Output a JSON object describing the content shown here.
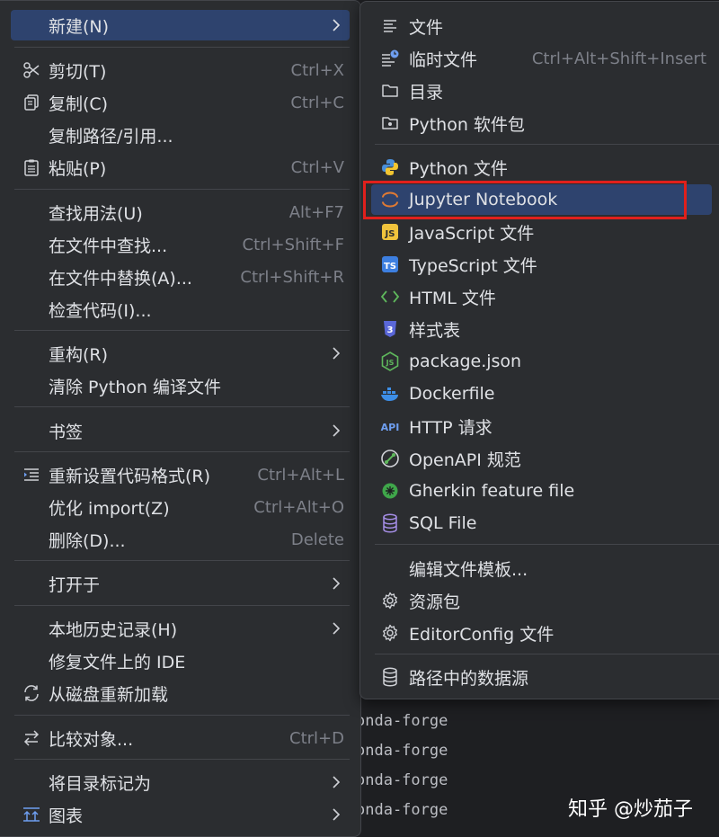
{
  "main_menu": {
    "new": "新建(N)",
    "cut": "剪切(T)",
    "cut_sc": "Ctrl+X",
    "copy": "复制(C)",
    "copy_sc": "Ctrl+C",
    "copy_path": "复制路径/引用...",
    "paste": "粘贴(P)",
    "paste_sc": "Ctrl+V",
    "find_usages": "查找用法(U)",
    "find_usages_sc": "Alt+F7",
    "find_in_files": "在文件中查找...",
    "find_in_files_sc": "Ctrl+Shift+F",
    "replace_in_files": "在文件中替换(A)...",
    "replace_in_files_sc": "Ctrl+Shift+R",
    "inspect_code": "检查代码(I)...",
    "refactor": "重构(R)",
    "clean_python": "清除 Python 编译文件",
    "bookmarks": "书签",
    "reformat": "重新设置代码格式(R)",
    "reformat_sc": "Ctrl+Alt+L",
    "optimize_imports": "优化 import(Z)",
    "optimize_imports_sc": "Ctrl+Alt+O",
    "delete": "删除(D)...",
    "delete_sc": "Delete",
    "open_in": "打开于",
    "local_history": "本地历史记录(H)",
    "repair_ide": "修复文件上的 IDE",
    "reload_disk": "从磁盘重新加载",
    "compare_with": "比较对象...",
    "compare_with_sc": "Ctrl+D",
    "mark_directory": "将目录标记为",
    "diagrams": "图表"
  },
  "sub_menu": {
    "file": "文件",
    "scratch_file": "临时文件",
    "scratch_file_sc": "Ctrl+Alt+Shift+Insert",
    "directory": "目录",
    "python_package": "Python 软件包",
    "python_file": "Python 文件",
    "jupyter_notebook": "Jupyter Notebook",
    "javascript_file": "JavaScript 文件",
    "typescript_file": "TypeScript 文件",
    "html_file": "HTML 文件",
    "stylesheet": "样式表",
    "package_json": "package.json",
    "dockerfile": "Dockerfile",
    "http_request": "HTTP 请求",
    "openapi": "OpenAPI 规范",
    "gherkin": "Gherkin feature file",
    "sql_file": "SQL File",
    "edit_templates": "编辑文件模板...",
    "resource_bundle": "资源包",
    "editorconfig": "EditorConfig 文件",
    "data_source_in_path": "路径中的数据源"
  },
  "terminal_lines": [
    "onda-forge",
    "onda-forge",
    "onda-forge",
    "onda-forge"
  ],
  "watermark": "知乎 @炒茄子",
  "colors": {
    "selected": "#2e436e",
    "highlight_box": "#e0201c",
    "menu_bg": "#2b2d30"
  }
}
